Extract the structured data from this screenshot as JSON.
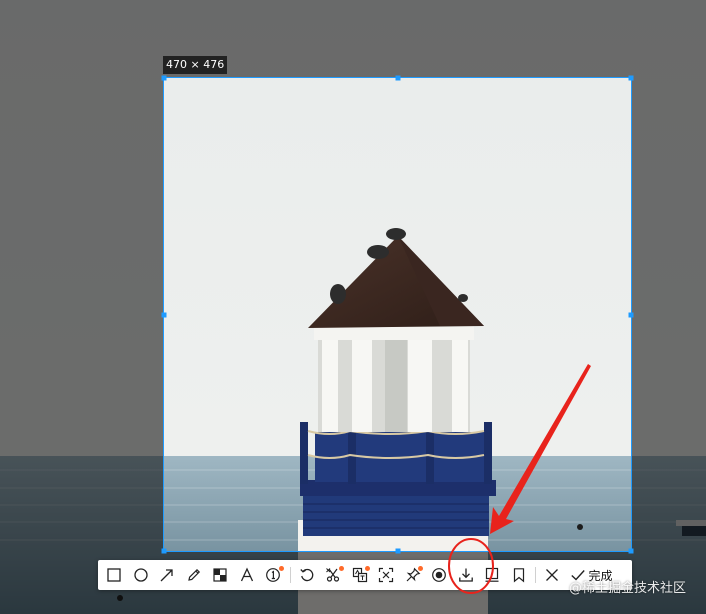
{
  "selection": {
    "size_label": "470 × 476",
    "accent_color": "#1e9bff"
  },
  "toolbar": {
    "tools": [
      {
        "icon": "rectangle-icon"
      },
      {
        "icon": "ellipse-icon"
      },
      {
        "icon": "arrow-icon"
      },
      {
        "icon": "pencil-icon"
      },
      {
        "icon": "mosaic-icon"
      },
      {
        "icon": "text-icon"
      },
      {
        "icon": "number-marker-icon"
      },
      {
        "icon": "undo-icon"
      },
      {
        "icon": "scissors-icon"
      },
      {
        "icon": "translate-icon"
      },
      {
        "icon": "ocr-scan-icon"
      },
      {
        "icon": "pin-icon"
      },
      {
        "icon": "record-icon"
      },
      {
        "icon": "download-icon"
      },
      {
        "icon": "long-screenshot-icon"
      },
      {
        "icon": "bookmark-icon"
      },
      {
        "icon": "close-icon"
      }
    ],
    "done_label": "完成",
    "dot_color": "#ff6a2a"
  },
  "watermark": "@稀土掘金技术社区",
  "annotation_color": "#e8231c"
}
